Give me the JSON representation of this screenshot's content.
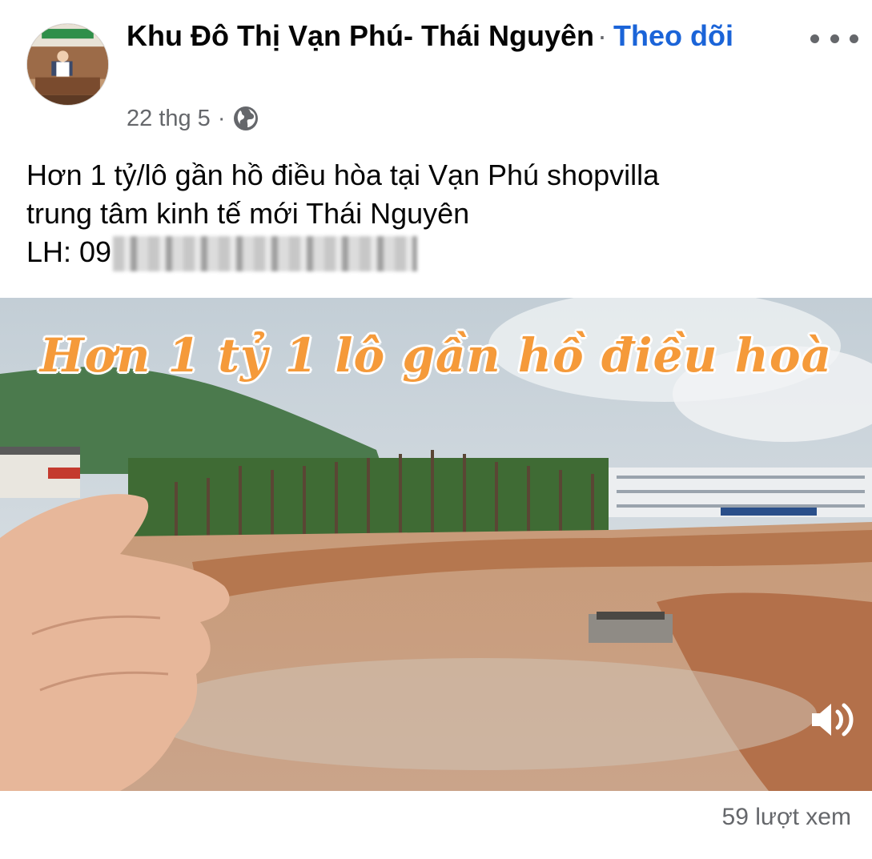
{
  "post": {
    "page_name": "Khu Đô Thị Vạn Phú- Thái Nguyên",
    "separator_dot": "·",
    "follow_label": "Theo dõi",
    "date": "22 thg 5",
    "meta_separator": "·",
    "privacy_icon": "globe-icon",
    "more_icon": "more-dots-icon",
    "text_lines": [
      "Hơn 1 tỷ/lô gần hồ điều hòa tại Vạn Phú shopvilla",
      "trung tâm kinh tế mới Thái Nguyên",
      "LH: 09"
    ]
  },
  "video": {
    "caption": "Hơn 1 tỷ 1 lô gần hồ điều hoà",
    "volume_icon": "volume-icon"
  },
  "footer": {
    "view_count": "59 lượt xem"
  },
  "colors": {
    "follow_link": "#1b64d8",
    "secondary_text": "#65676b",
    "caption_orange": "#f59a3a"
  }
}
